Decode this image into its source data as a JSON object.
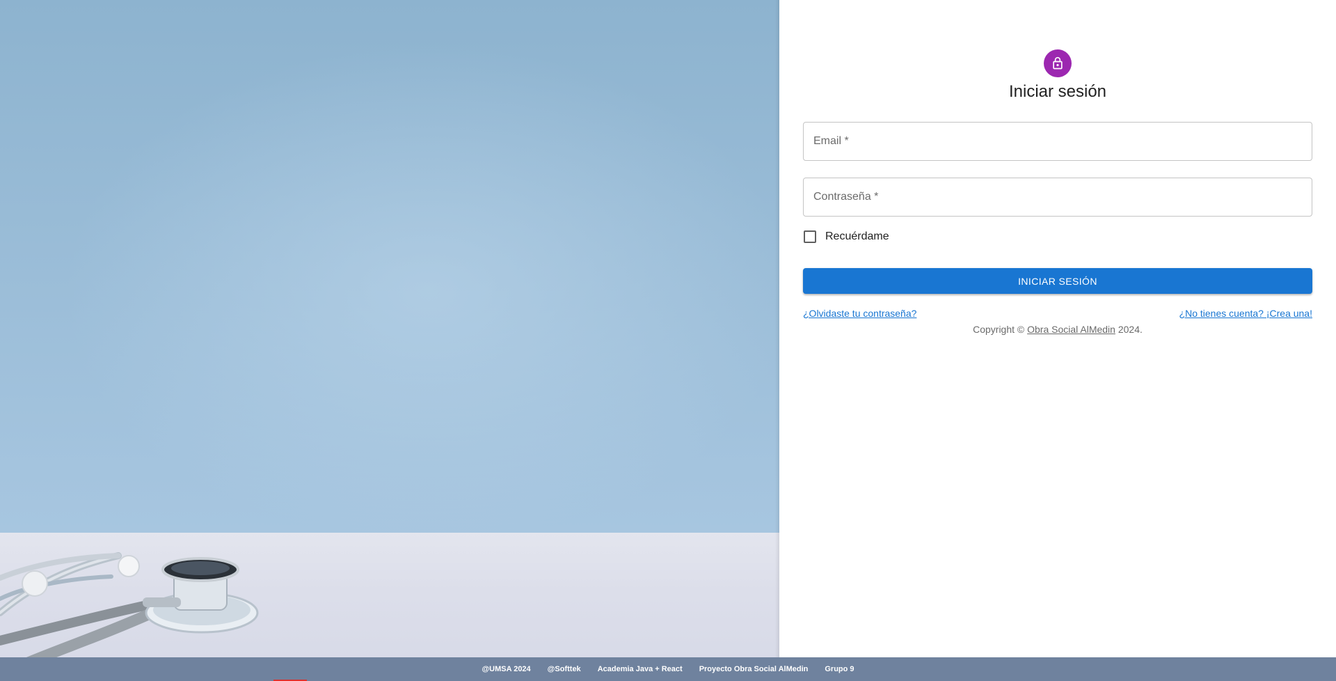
{
  "login": {
    "title": "Iniciar sesión",
    "email_label": "Email *",
    "password_label": "Contraseña *",
    "email_value": "",
    "password_value": "",
    "remember_label": "Recuérdame",
    "remember_checked": false,
    "submit_label": "INICIAR SESIÓN",
    "forgot_link": "¿Olvidaste tu contraseña?",
    "register_link": "¿No tienes cuenta? ¡Crea una!",
    "copyright_prefix": "Copyright © ",
    "copyright_link": "Obra Social AlMedin",
    "copyright_suffix": " 2024.",
    "lock_icon": "lock-icon",
    "avatar_color": "#9c27b0",
    "primary_color": "#1976d2"
  },
  "hero": {
    "image": "stethoscope-on-table"
  },
  "footer": {
    "items": [
      "@UMSA 2024",
      "@Softtek",
      "Academia Java + React",
      "Proyecto Obra Social AlMedin",
      "Grupo 9"
    ],
    "background_color": "#6f829e"
  }
}
